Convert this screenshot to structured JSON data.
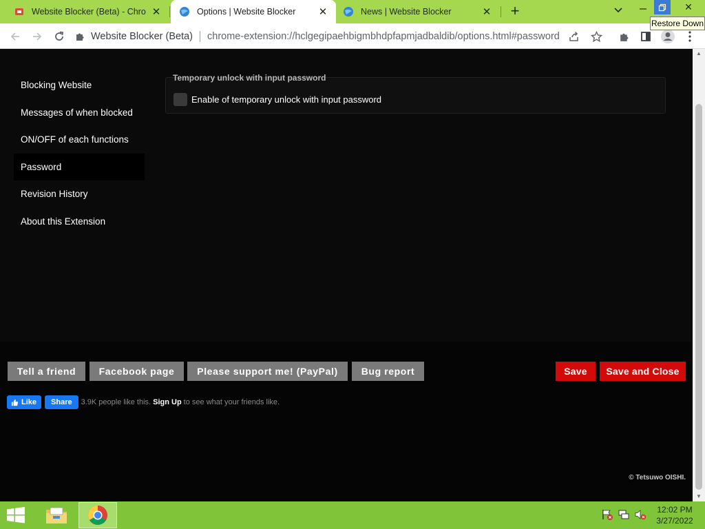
{
  "browser": {
    "tabs": [
      {
        "title": "Website Blocker (Beta) - Chrome",
        "active": false,
        "icon": "puzzle-favicon"
      },
      {
        "title": "Options | Website Blocker",
        "active": true,
        "icon": "globe-favicon"
      },
      {
        "title": "News | Website Blocker",
        "active": false,
        "icon": "globe-favicon"
      }
    ],
    "tooltip": "Restore Down",
    "address": {
      "site": "Website Blocker (Beta)",
      "url": "chrome-extension://hclgegipaehbigmbhdpfapmjadbaldib/options.html#password"
    },
    "colors": {
      "tabstrip": "#a6d84f",
      "taskbar": "#80c43a",
      "accent": "#3b7bd4"
    }
  },
  "sidebar": {
    "items": [
      {
        "label": "Blocking Website",
        "active": false
      },
      {
        "label": "Messages of when blocked",
        "active": false
      },
      {
        "label": "ON/OFF of each functions",
        "active": false
      },
      {
        "label": "Password",
        "active": true
      },
      {
        "label": "Revision History",
        "active": false
      },
      {
        "label": "About this Extension",
        "active": false
      }
    ]
  },
  "password_section": {
    "title": "Temporary unlock with input password",
    "checkbox_label": "Enable of temporary unlock with input password",
    "checked": false
  },
  "footer": {
    "buttons": {
      "tell_friend": "Tell a friend",
      "facebook": "Facebook page",
      "support": "Please support me! (PayPal)",
      "bug": "Bug report",
      "save": "Save",
      "save_close": "Save and Close"
    },
    "facebook_widget": {
      "like": "Like",
      "share": "Share",
      "count_text": "3.9K people like this.",
      "signup": "Sign Up",
      "suffix": "to see what your friends like."
    },
    "copyright": "© Tetsuwo OISHI.",
    "colors": {
      "save": "#d20a0a",
      "gray": "#7a7a7a",
      "facebook": "#1877f2"
    }
  },
  "taskbar": {
    "time": "12:02 PM",
    "date": "3/27/2022",
    "apps": [
      "file-explorer-icon",
      "chrome-icon"
    ]
  }
}
